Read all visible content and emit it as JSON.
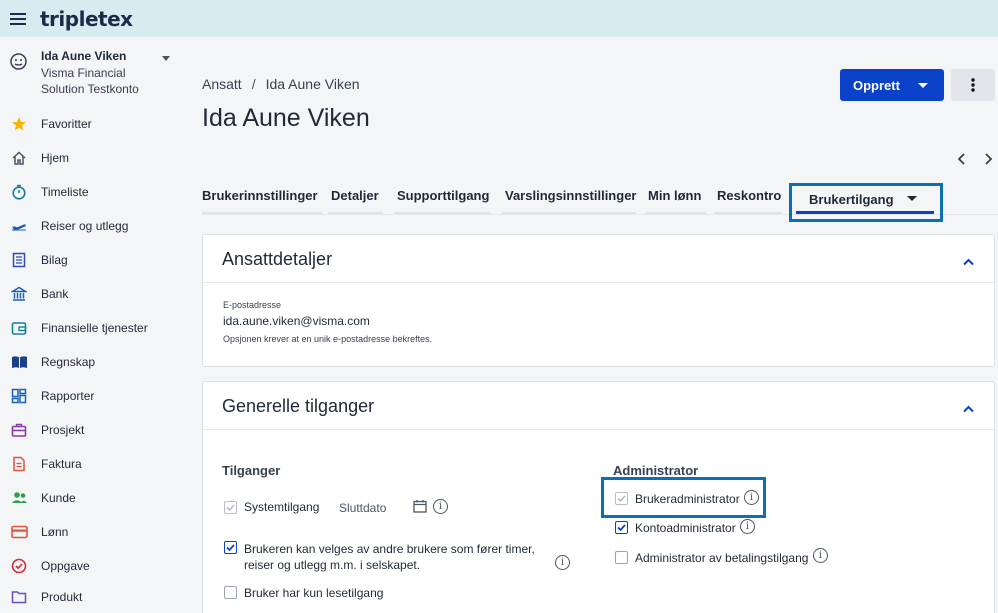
{
  "app": {
    "logo": "tripletex"
  },
  "account": {
    "name": "Ida Aune Viken",
    "company": "Visma Financial Solution Testkonto"
  },
  "sidebar": {
    "items": [
      {
        "label": "Favoritter",
        "icon": "star-icon"
      },
      {
        "label": "Hjem",
        "icon": "home-icon"
      },
      {
        "label": "Timeliste",
        "icon": "stopwatch-icon"
      },
      {
        "label": "Reiser og utlegg",
        "icon": "airplane-icon"
      },
      {
        "label": "Bilag",
        "icon": "document-list-icon"
      },
      {
        "label": "Bank",
        "icon": "bank-icon"
      },
      {
        "label": "Finansielle tjenester",
        "icon": "wallet-icon"
      },
      {
        "label": "Regnskap",
        "icon": "book-icon"
      },
      {
        "label": "Rapporter",
        "icon": "dashboard-icon"
      },
      {
        "label": "Prosjekt",
        "icon": "briefcase-icon"
      },
      {
        "label": "Faktura",
        "icon": "invoice-icon"
      },
      {
        "label": "Kunde",
        "icon": "people-icon"
      },
      {
        "label": "Lønn",
        "icon": "credit-card-icon"
      },
      {
        "label": "Oppgave",
        "icon": "check-circle-icon"
      },
      {
        "label": "Produkt",
        "icon": "folder-icon"
      }
    ]
  },
  "breadcrumb": {
    "parent": "Ansatt",
    "separator": "/",
    "current": "Ida Aune Viken"
  },
  "page": {
    "title": "Ida Aune Viken"
  },
  "header_actions": {
    "create_label": "Opprett"
  },
  "tabs": {
    "items": [
      "Brukerinnstillinger",
      "Detaljer",
      "Supporttilgang",
      "Varslingsinnstillinger",
      "Min lønn",
      "Reskontro"
    ],
    "active": "Brukertilgang"
  },
  "employee_details": {
    "title": "Ansattdetaljer",
    "email_label": "E-postadresse",
    "email_value": "ida.aune.viken@visma.com",
    "email_hint": "Opsjonen krever at en unik e-postadresse bekreftes."
  },
  "general_access": {
    "title": "Generelle tilganger",
    "access_heading": "Tilganger",
    "system_access_label": "Systemtilgang",
    "end_date_label": "Sluttdato",
    "selectable_label_line1": "Brukeren kan velges av andre brukere som fører timer,",
    "selectable_label_line2": "reiser og utlegg m.m. i selskapet.",
    "readonly_label": "Bruker har kun lesetilgang",
    "admin_heading": "Administrator",
    "user_admin_label": "Brukeradministrator",
    "account_admin_label": "Kontoadministrator",
    "payment_admin_label": "Administrator av betalingstilgang"
  },
  "colors": {
    "primary": "#0a41c9",
    "highlight": "#0a6fb6",
    "topbar": "#d6ecf0"
  }
}
